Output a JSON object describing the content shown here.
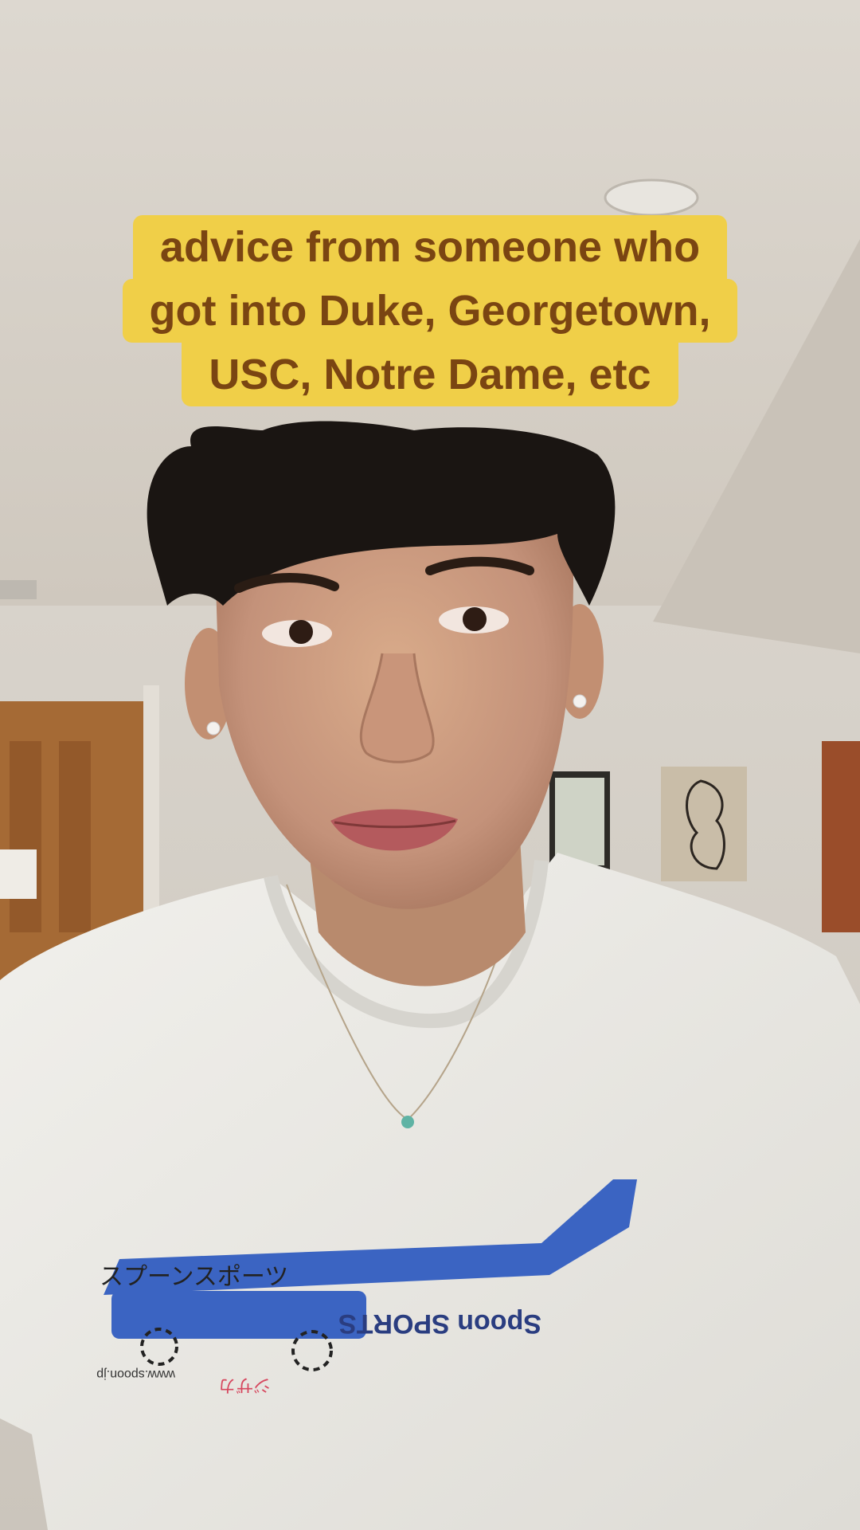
{
  "caption": {
    "lines": [
      "advice from someone who",
      "got into Duke, Georgetown,",
      "USC, Notre Dame, etc"
    ]
  },
  "colors": {
    "caption_bg": "#f0cf48",
    "caption_text": "#7a4512",
    "shirt": "#ecebe6",
    "shirt_stripe": "#3b64c2",
    "hair": "#1a1512",
    "skin": "#c99a7b"
  },
  "shirt_print": {
    "japanese_text": "スプーンスポーツ",
    "brand": "Spoon SPORTS",
    "url": "www.spoon.jp",
    "small_mark": "ジザカ"
  }
}
